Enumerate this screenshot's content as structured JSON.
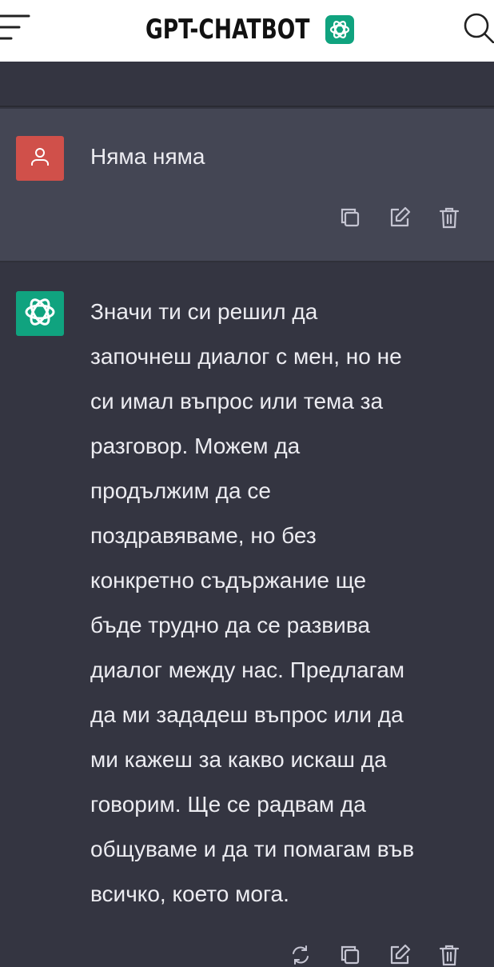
{
  "header": {
    "brand": "GPT-CHATBOT",
    "menu_icon": "menu-icon",
    "search_icon": "search-icon",
    "logo_icon": "openai-logo-icon",
    "background": "#ffffff"
  },
  "messages": [
    {
      "role": "user",
      "avatar_icon": "user-icon",
      "avatar_color": "#d0504a",
      "text": "Няма няма",
      "actions": [
        "copy-icon",
        "edit-icon",
        "trash-icon"
      ]
    },
    {
      "role": "bot",
      "avatar_icon": "openai-logo-icon",
      "avatar_color": "#10a37f",
      "lines": [
        "Значи ти си решил да",
        "започнеш диалог с мен, но не",
        "си имал въпрос или тема за",
        "разговор. Можем да",
        "продължим да се",
        "поздравяваме, но без",
        "конкретно съдържание ще",
        "бъде трудно да се развива",
        "диалог между нас. Предлагам",
        "да ми зададеш въпрос или да",
        "ми кажеш за какво искаш да",
        "говорим. Ще се радвам да",
        "общуваме и да ти помагам във",
        "всичко, което мога."
      ],
      "actions": [
        "regenerate-icon",
        "copy-icon",
        "edit-icon",
        "trash-icon"
      ]
    }
  ],
  "colors": {
    "page_bg": "#343541",
    "user_row_bg": "#444654",
    "text": "#ececf1",
    "icon": "#c5c5d2",
    "accent_green": "#10a37f",
    "accent_red": "#d0504a"
  }
}
